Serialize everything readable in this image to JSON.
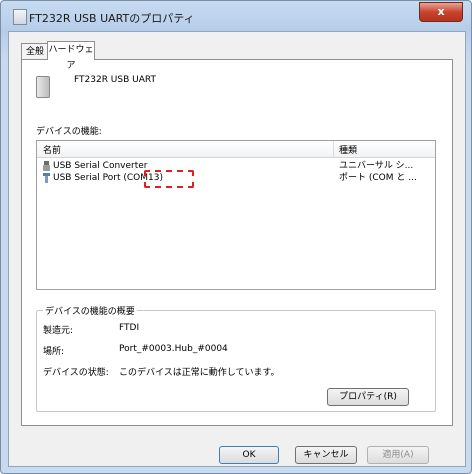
{
  "window": {
    "title": "FT232R USB UARTのプロパティ",
    "close_label": "x"
  },
  "tabs": [
    {
      "label": "全般"
    },
    {
      "label": "ハードウェア"
    }
  ],
  "device": {
    "name": "FT232R USB UART"
  },
  "functions": {
    "label": "デバイスの機能:",
    "columns": {
      "name": "名前",
      "type": "種類"
    },
    "rows": [
      {
        "name": "USB Serial Converter",
        "type": "ユニバーサル シ..."
      },
      {
        "name": "USB Serial Port (COM13)",
        "type": "ポート (COM と ..."
      }
    ],
    "highlight_color": "#e02020"
  },
  "summary": {
    "legend": "デバイスの機能の概要",
    "manufacturer_label": "製造元:",
    "manufacturer_value": "FTDI",
    "location_label": "場所:",
    "location_value": "Port_#0003.Hub_#0004",
    "status_label": "デバイスの状態:",
    "status_value": "このデバイスは正常に動作しています。"
  },
  "buttons": {
    "properties": "プロパティ(R)",
    "ok": "OK",
    "cancel": "キャンセル",
    "apply": "適用(A)"
  }
}
